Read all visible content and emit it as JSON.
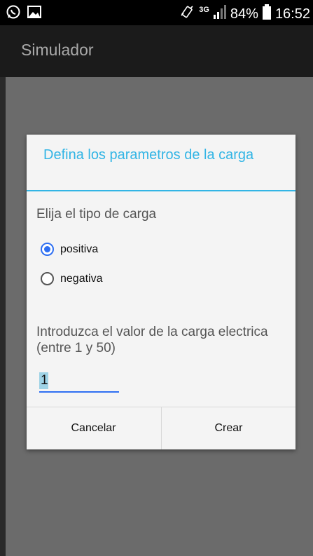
{
  "status_bar": {
    "network": "3G",
    "battery_percent": "84%",
    "time": "16:52",
    "icons": [
      "whatsapp-icon",
      "image-icon",
      "vibrate-icon",
      "signal-icon",
      "battery-icon"
    ]
  },
  "app": {
    "title": "Simulador"
  },
  "dialog": {
    "title": "Defina los parametros de la carga",
    "prompt": "Elija el tipo de carga",
    "options": [
      {
        "label": "positiva",
        "checked": true
      },
      {
        "label": "negativa",
        "checked": false
      }
    ],
    "value_prompt": "Introduzca el valor de la carga electrica (entre 1 y 50)",
    "value": "1",
    "cancel_label": "Cancelar",
    "create_label": "Crear"
  },
  "colors": {
    "accent": "#33b5e5",
    "radio_checked": "#2e6ff2",
    "scrim": "#6b6b6b",
    "action_bar": "#1b1b1b"
  }
}
